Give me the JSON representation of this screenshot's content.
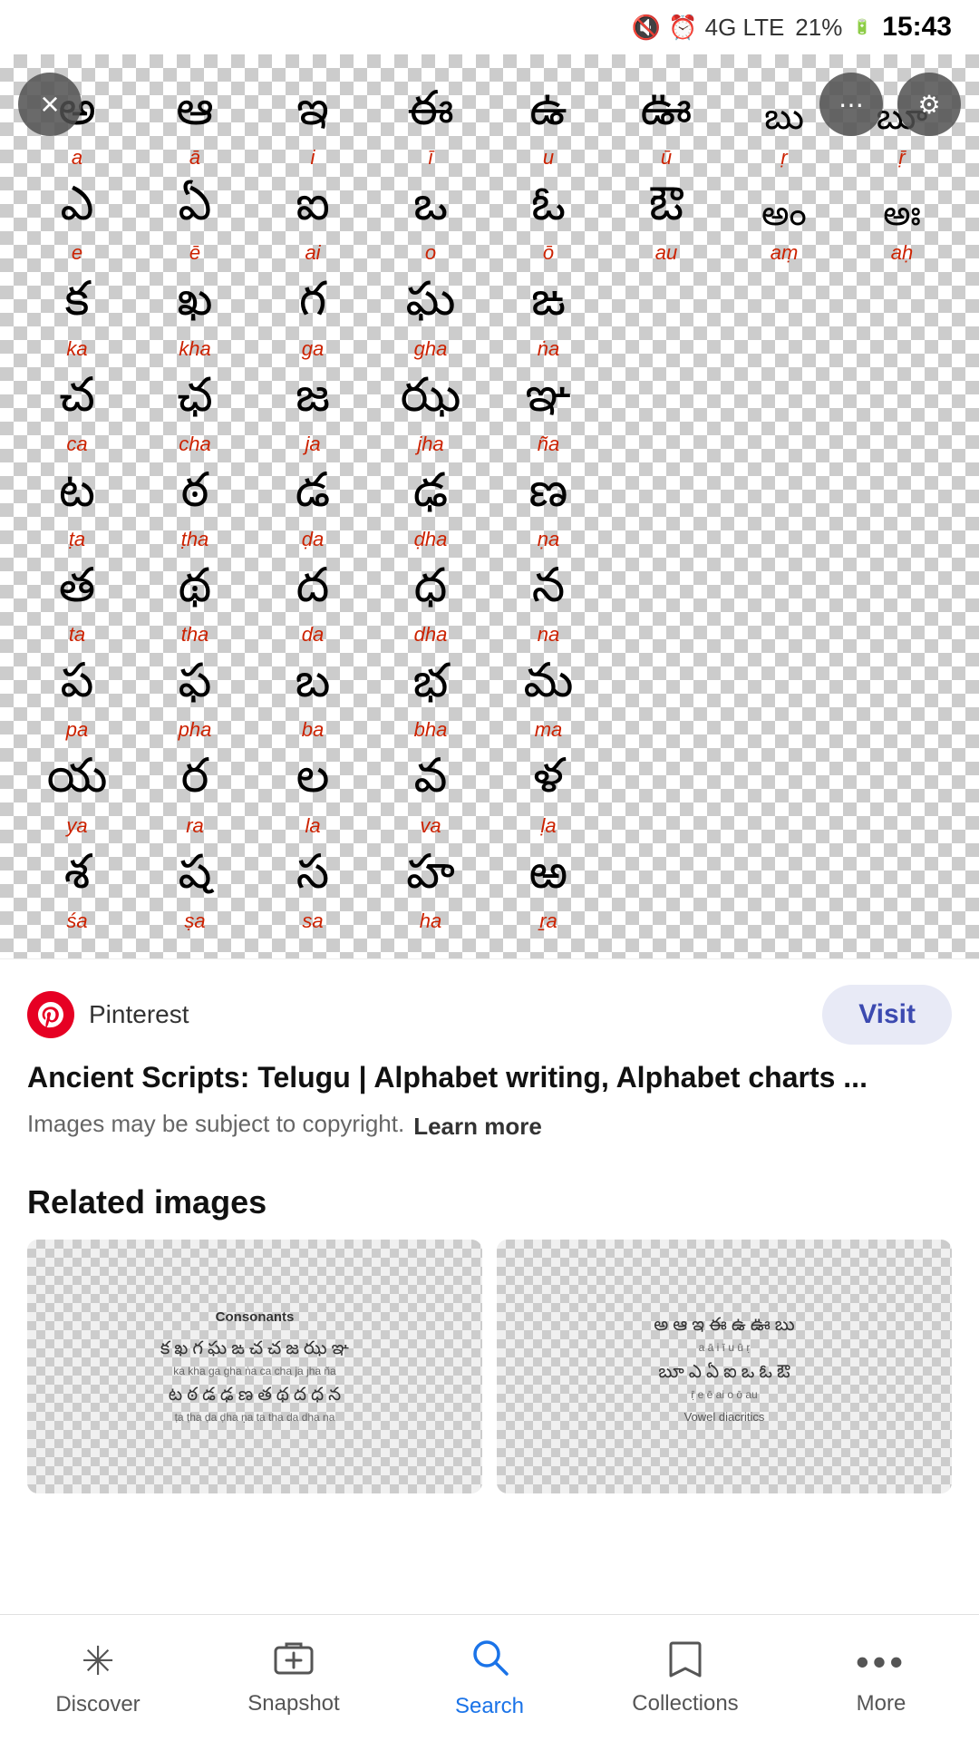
{
  "statusBar": {
    "time": "15:43",
    "battery": "21%",
    "network": "4G LTE"
  },
  "imageArea": {
    "closeButton": "×",
    "alphabetRows": [
      [
        {
          "char": "అ",
          "label": "a"
        },
        {
          "char": "ఆ",
          "label": "ā"
        },
        {
          "char": "ఇ",
          "label": "i"
        },
        {
          "char": "ఈ",
          "label": "ī"
        },
        {
          "char": "ఉ",
          "label": "u"
        },
        {
          "char": "ఊ",
          "label": "ū"
        },
        {
          "char": "బు",
          "label": "ṛ"
        },
        {
          "char": "బూ",
          "label": "ṝ"
        }
      ],
      [
        {
          "char": "ఎ",
          "label": "e"
        },
        {
          "char": "ఏ",
          "label": "ē"
        },
        {
          "char": "ఐ",
          "label": "ai"
        },
        {
          "char": "ఒ",
          "label": "o"
        },
        {
          "char": "ఓ",
          "label": "ō"
        },
        {
          "char": "ఔ",
          "label": "au"
        },
        {
          "char": "అం",
          "label": "aṃ"
        },
        {
          "char": "అః",
          "label": "aḥ"
        }
      ],
      [
        {
          "char": "క",
          "label": "ka"
        },
        {
          "char": "ఖ",
          "label": "kha"
        },
        {
          "char": "గ",
          "label": "ga"
        },
        {
          "char": "ఘ",
          "label": "gha"
        },
        {
          "char": "ఙ",
          "label": "ṅa"
        },
        {
          "char": "",
          "label": ""
        },
        {
          "char": "",
          "label": ""
        },
        {
          "char": "",
          "label": ""
        }
      ],
      [
        {
          "char": "చ",
          "label": "ca"
        },
        {
          "char": "ఛ",
          "label": "cha"
        },
        {
          "char": "జ",
          "label": "ja"
        },
        {
          "char": "ఝ",
          "label": "jha"
        },
        {
          "char": "ఞ",
          "label": "ña"
        },
        {
          "char": "",
          "label": ""
        },
        {
          "char": "",
          "label": ""
        },
        {
          "char": "",
          "label": ""
        }
      ],
      [
        {
          "char": "ట",
          "label": "ṭa"
        },
        {
          "char": "ఠ",
          "label": "ṭha"
        },
        {
          "char": "డ",
          "label": "ḍa"
        },
        {
          "char": "ఢ",
          "label": "ḍha"
        },
        {
          "char": "ణ",
          "label": "ṇa"
        },
        {
          "char": "",
          "label": ""
        },
        {
          "char": "",
          "label": ""
        },
        {
          "char": "",
          "label": ""
        }
      ],
      [
        {
          "char": "త",
          "label": "ta"
        },
        {
          "char": "థ",
          "label": "tha"
        },
        {
          "char": "ద",
          "label": "da"
        },
        {
          "char": "ధ",
          "label": "dha"
        },
        {
          "char": "న",
          "label": "na"
        },
        {
          "char": "",
          "label": ""
        },
        {
          "char": "",
          "label": ""
        },
        {
          "char": "",
          "label": ""
        }
      ],
      [
        {
          "char": "ప",
          "label": "pa"
        },
        {
          "char": "ఫ",
          "label": "pha"
        },
        {
          "char": "బ",
          "label": "ba"
        },
        {
          "char": "భ",
          "label": "bha"
        },
        {
          "char": "మ",
          "label": "ma"
        },
        {
          "char": "",
          "label": ""
        },
        {
          "char": "",
          "label": ""
        },
        {
          "char": "",
          "label": ""
        }
      ],
      [
        {
          "char": "య",
          "label": "ya"
        },
        {
          "char": "ర",
          "label": "ra"
        },
        {
          "char": "ల",
          "label": "la"
        },
        {
          "char": "వ",
          "label": "va"
        },
        {
          "char": "ళ",
          "label": "ḷa"
        },
        {
          "char": "",
          "label": ""
        },
        {
          "char": "",
          "label": ""
        },
        {
          "char": "",
          "label": ""
        }
      ],
      [
        {
          "char": "శ",
          "label": "śa"
        },
        {
          "char": "ష",
          "label": "ṣa"
        },
        {
          "char": "స",
          "label": "sa"
        },
        {
          "char": "హ",
          "label": "ha"
        },
        {
          "char": "ఱ",
          "label": "ṟa"
        },
        {
          "char": "",
          "label": ""
        },
        {
          "char": "",
          "label": ""
        },
        {
          "char": "",
          "label": ""
        }
      ]
    ]
  },
  "infoSection": {
    "sourceName": "Pinterest",
    "visitLabel": "Visit",
    "title": "Ancient Scripts: Telugu | Alphabet writing, Alphabet charts ...",
    "copyrightText": "Images may be subject to copyright.",
    "learnMoreLabel": "Learn more"
  },
  "relatedSection": {
    "title": "Related images",
    "thumbs": [
      {
        "label": "Telugu Consonants chart"
      },
      {
        "label": "Telugu Vowel diacritics"
      }
    ]
  },
  "bottomNav": {
    "items": [
      {
        "id": "discover",
        "label": "Discover",
        "icon": "✳",
        "active": false
      },
      {
        "id": "snapshot",
        "label": "Snapshot",
        "icon": "⬛",
        "active": false
      },
      {
        "id": "search",
        "label": "Search",
        "icon": "🔍",
        "active": true
      },
      {
        "id": "collections",
        "label": "Collections",
        "icon": "🔖",
        "active": false
      },
      {
        "id": "more",
        "label": "More",
        "icon": "•••",
        "active": false
      }
    ]
  }
}
